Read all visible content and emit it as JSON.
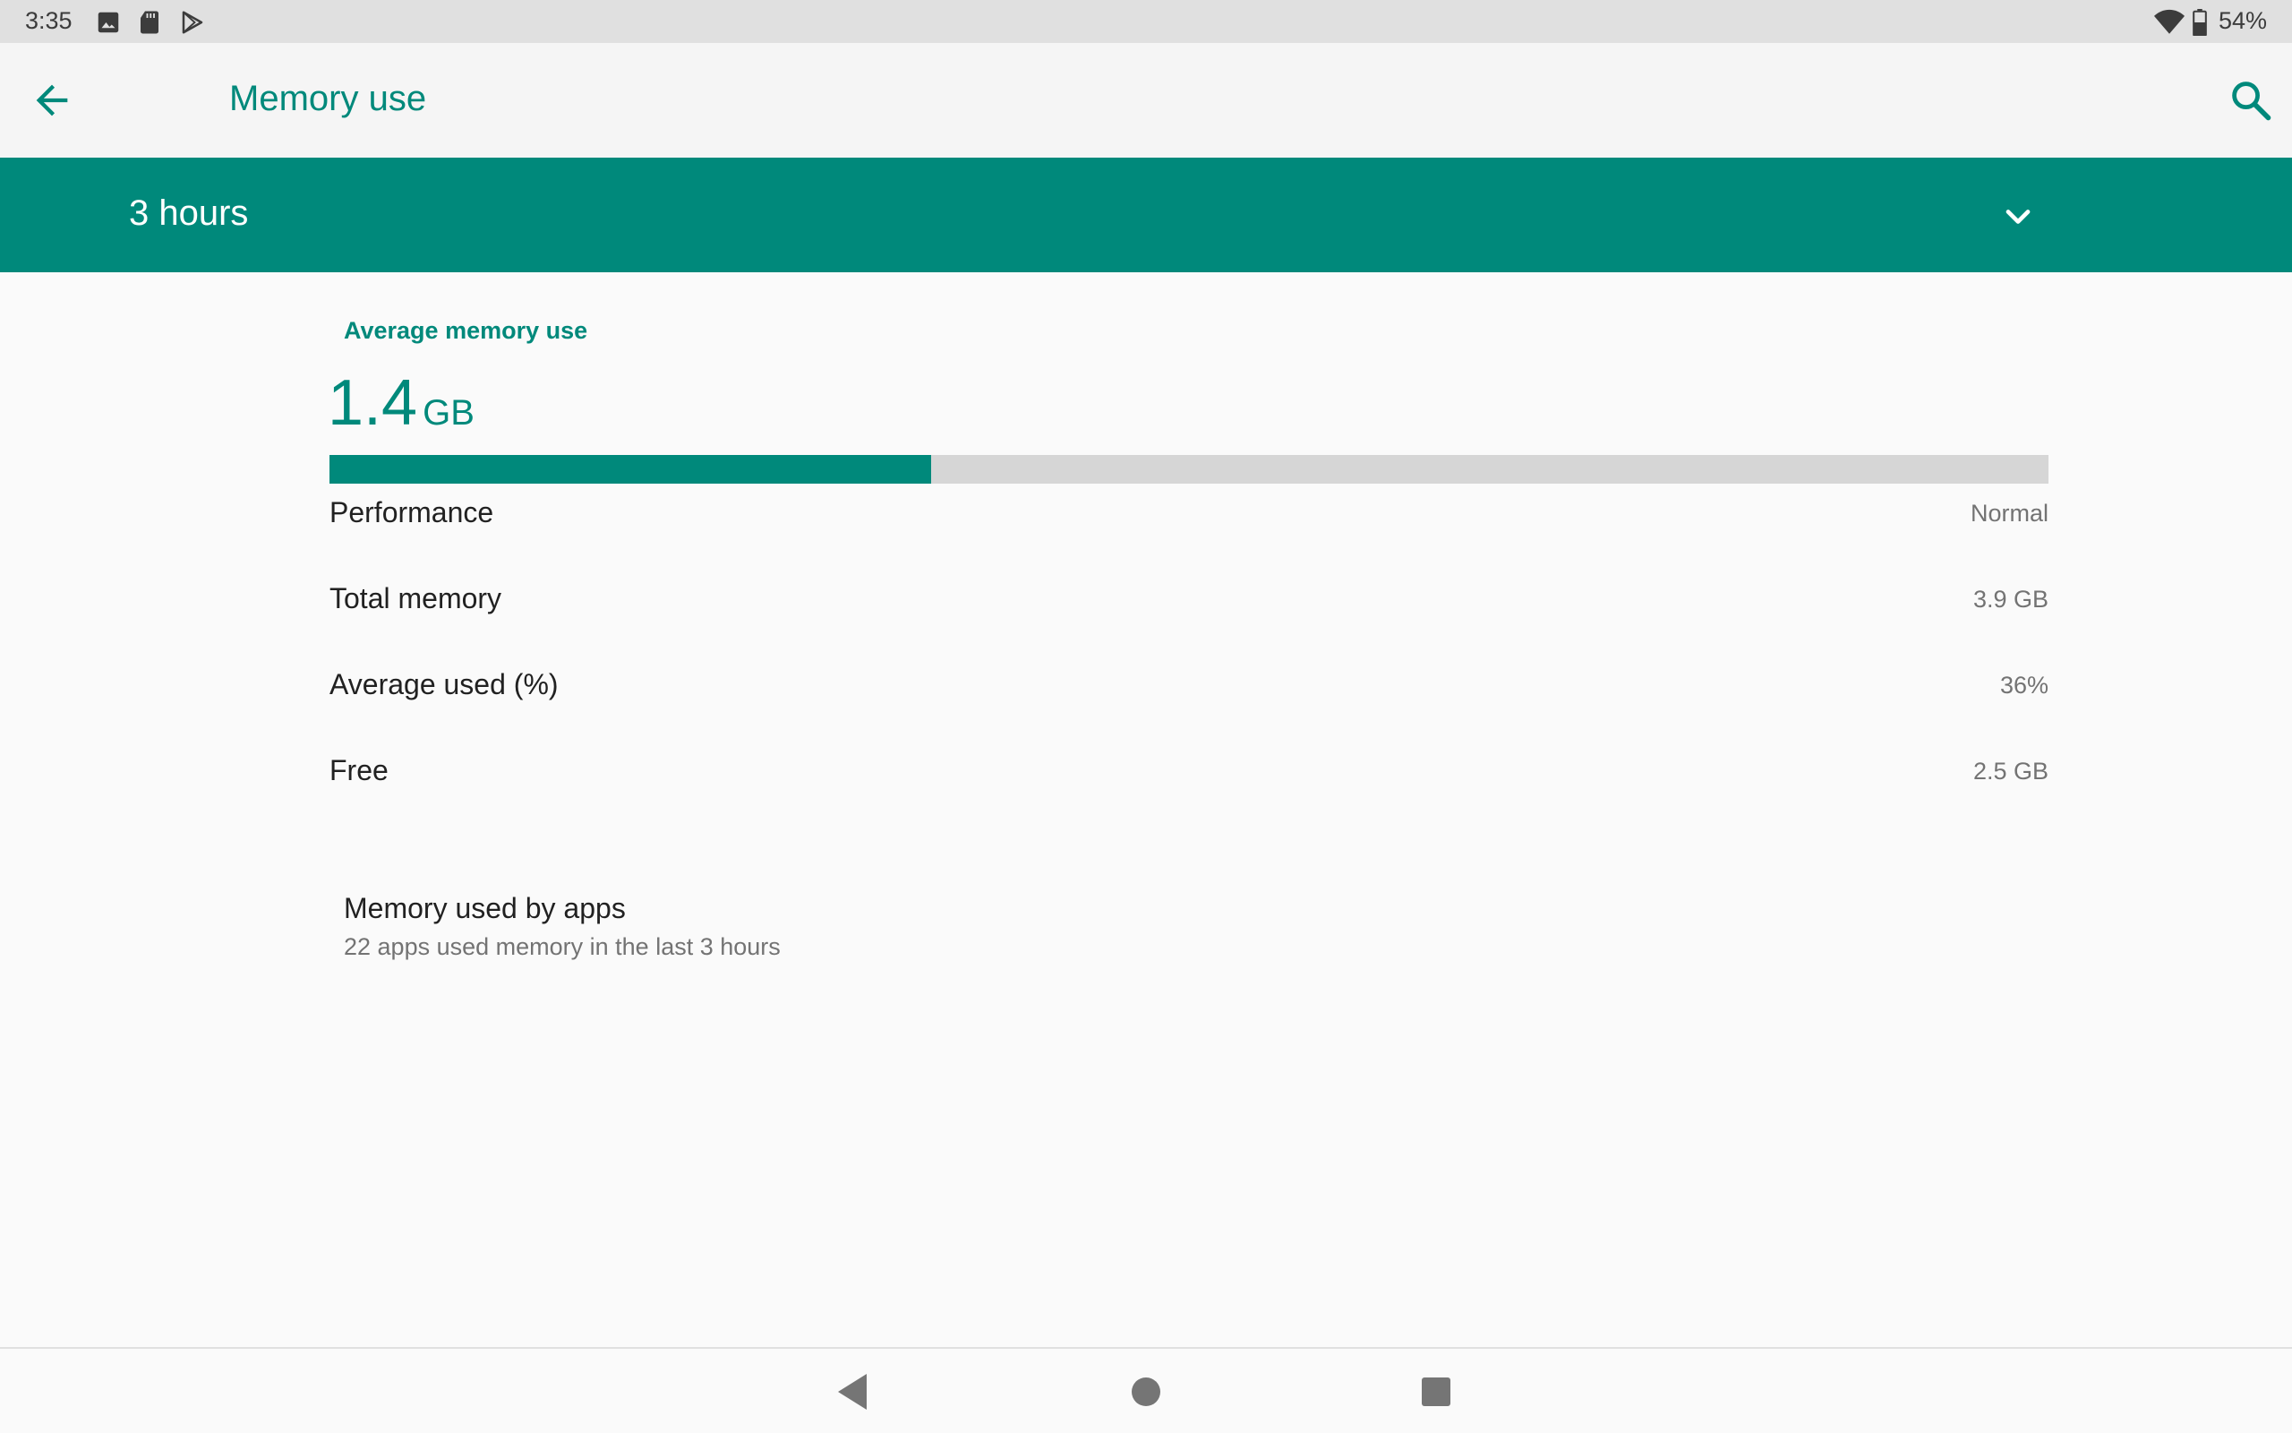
{
  "status_bar": {
    "time": "3:35",
    "battery": "54%",
    "icons": [
      "image-icon",
      "sd-card-icon",
      "play-store-icon",
      "wifi-icon",
      "battery-icon"
    ]
  },
  "app_bar": {
    "title": "Memory use",
    "icons": [
      "back-arrow-icon",
      "search-icon"
    ]
  },
  "spinner": {
    "selected": "3 hours"
  },
  "summary": {
    "label": "Average memory use",
    "value": "1.4",
    "unit": "GB",
    "progress_fraction": 0.35
  },
  "stats": [
    {
      "label": "Performance",
      "value": "Normal"
    },
    {
      "label": "Total memory",
      "value": "3.9 GB"
    },
    {
      "label": "Average used (%)",
      "value": "36%"
    },
    {
      "label": "Free",
      "value": "2.5 GB"
    }
  ],
  "apps": {
    "title": "Memory used by apps",
    "summary": "22 apps used memory in the last 3 hours"
  },
  "nav": {
    "icons": [
      "back-triangle-icon",
      "home-circle-icon",
      "recents-square-icon"
    ]
  },
  "colors": {
    "accent": "#00897b",
    "track": "#d6d6d6",
    "background": "#fafafa"
  }
}
